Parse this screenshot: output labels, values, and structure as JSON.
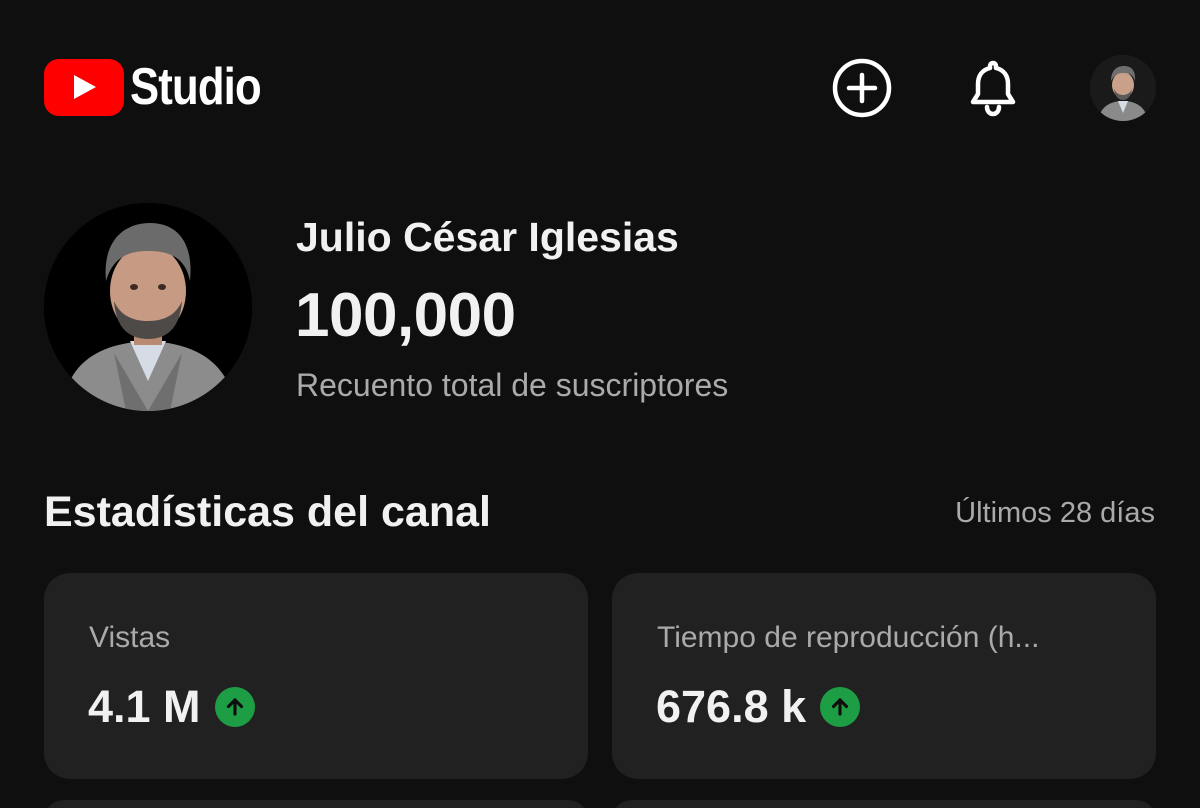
{
  "header": {
    "logo_text": "Studio",
    "create_icon": "add-circle-icon",
    "notifications_icon": "bell-icon",
    "account_avatar": "account-avatar"
  },
  "channel": {
    "name": "Julio César Iglesias",
    "subscriber_count": "100,000",
    "subscriber_label": "Recuento total de suscriptores"
  },
  "stats": {
    "title": "Estadísticas del canal",
    "period": "Últimos 28 días",
    "cards": [
      {
        "label": "Vistas",
        "value": "4.1 M",
        "trend_icon": "arrow-up-icon"
      },
      {
        "label": "Tiempo de reproducción (h...",
        "value": "676.8 k",
        "trend_icon": "arrow-up-icon"
      }
    ]
  },
  "colors": {
    "background": "#0f0f0f",
    "card": "#212121",
    "brand_red": "#ff0000",
    "trend_up": "#1e9e44",
    "text_primary": "#f1f1f1",
    "text_secondary": "#aaaaaa"
  }
}
